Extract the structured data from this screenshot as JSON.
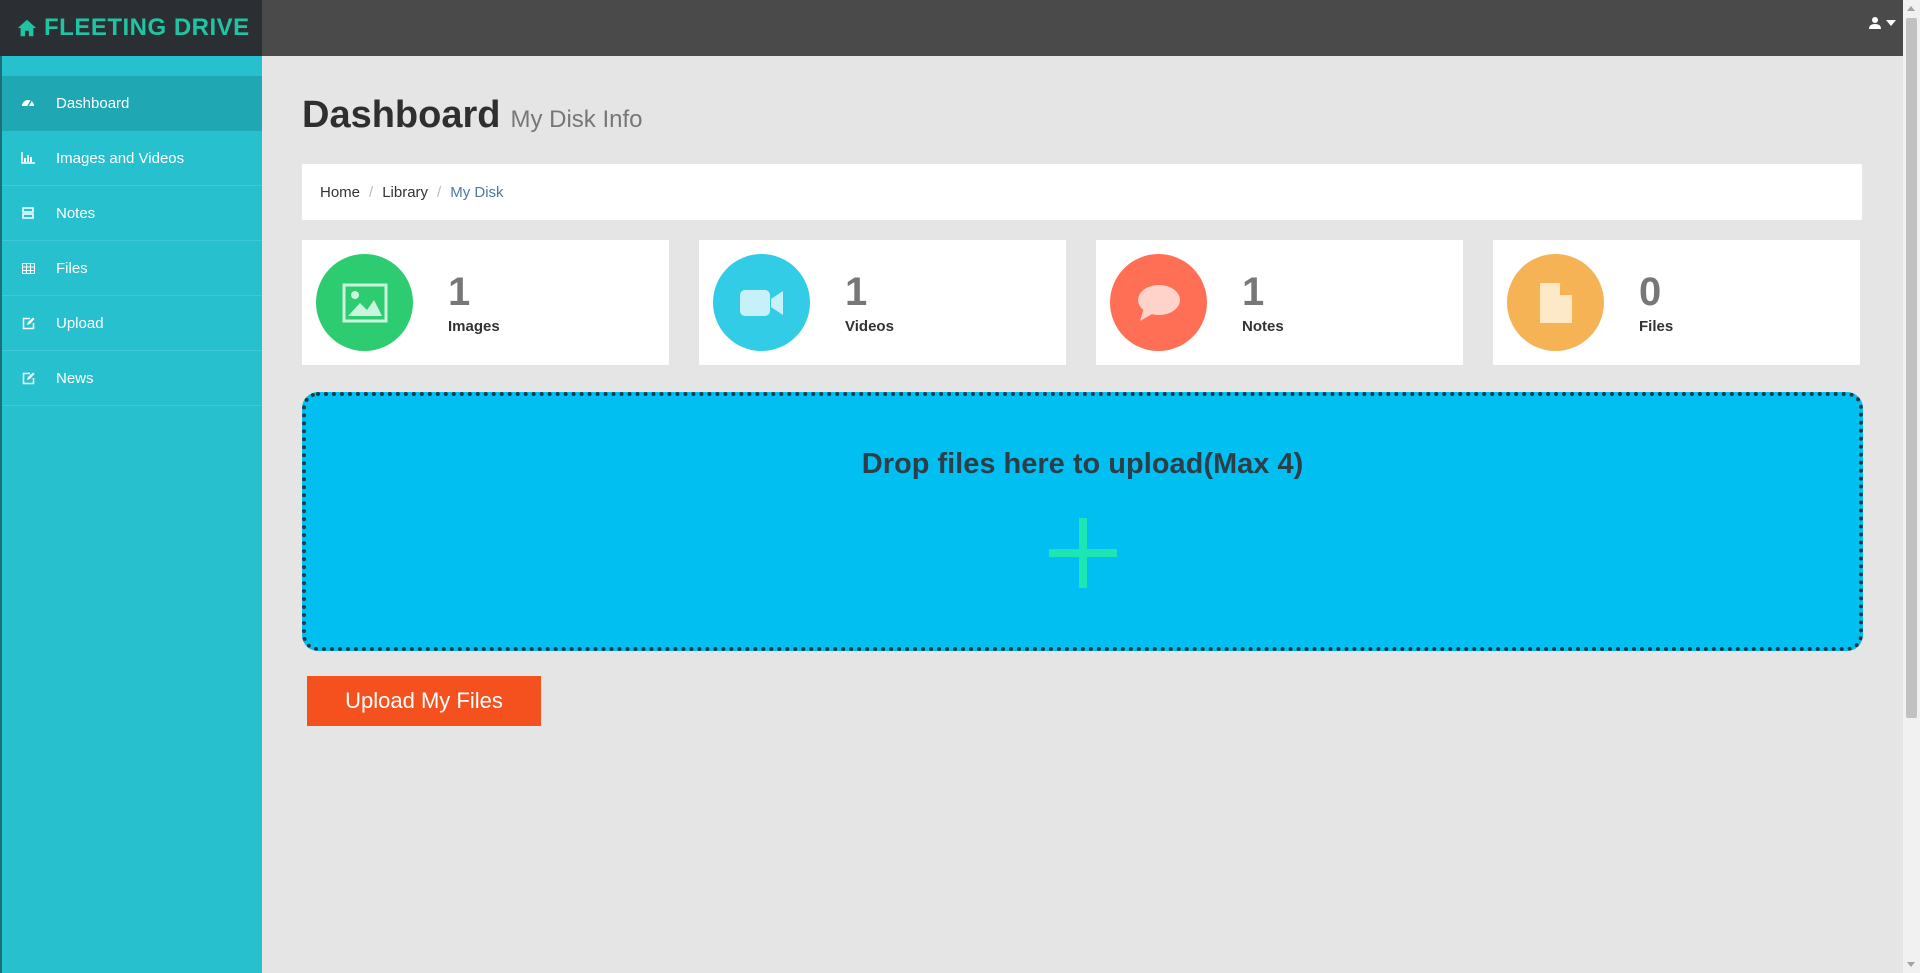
{
  "brand": {
    "name": "FLEETING DRIVE",
    "color": "#1fc4a3"
  },
  "sidebar": {
    "items": [
      {
        "label": "Dashboard",
        "icon": "dashboard-icon",
        "active": true
      },
      {
        "label": "Images and Videos",
        "icon": "bar-chart-icon"
      },
      {
        "label": "Notes",
        "icon": "notes-icon"
      },
      {
        "label": "Files",
        "icon": "table-icon"
      },
      {
        "label": "Upload",
        "icon": "edit-icon"
      },
      {
        "label": "News",
        "icon": "edit-icon"
      }
    ]
  },
  "header": {
    "title": "Dashboard",
    "subtitle": "My Disk Info"
  },
  "breadcrumb": {
    "home": "Home",
    "library": "Library",
    "current": "My Disk"
  },
  "stats": [
    {
      "value": "1",
      "label": "Images",
      "color": "#2ecc71",
      "icon": "image-icon"
    },
    {
      "value": "1",
      "label": "Videos",
      "color": "#32cce6",
      "icon": "video-camera-icon"
    },
    {
      "value": "1",
      "label": "Notes",
      "color": "#ff6f55",
      "icon": "comment-icon"
    },
    {
      "value": "0",
      "label": "Files",
      "color": "#f5b356",
      "icon": "file-icon"
    }
  ],
  "dropzone": {
    "text": "Drop files here to upload(Max 4)",
    "color": "#02bff1",
    "plus_color": "#1ee6b3"
  },
  "upload_button": {
    "label": "Upload My Files",
    "color": "#f4511e"
  }
}
